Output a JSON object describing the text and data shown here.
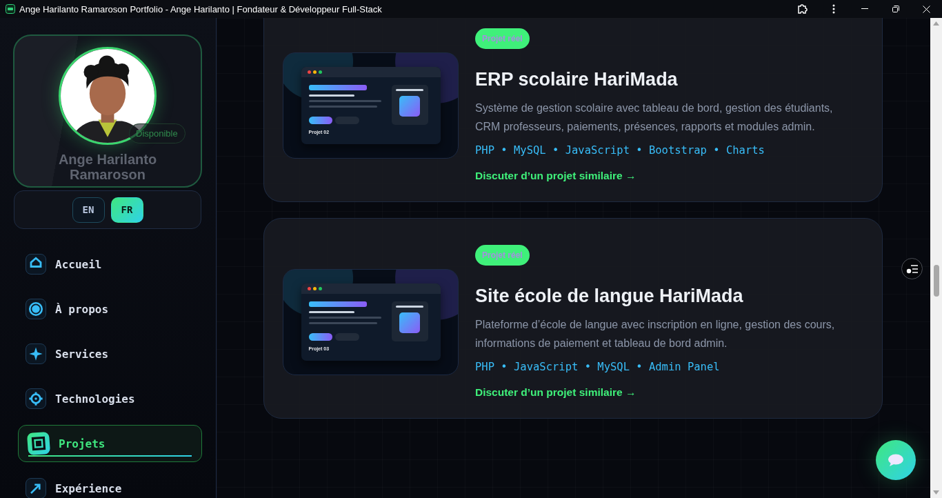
{
  "window": {
    "title": "Ange Harilanto Ramaroson Portfolio - Ange Harilanto | Fondateur & Développeur Full-Stack"
  },
  "profile": {
    "status": "Disponible",
    "name_lines": [
      "Ange Harilanto",
      "Ramaroson"
    ]
  },
  "languages": [
    {
      "label": "EN",
      "selected": false
    },
    {
      "label": "FR",
      "selected": true
    }
  ],
  "nav": [
    {
      "label": "Accueil",
      "selected": false
    },
    {
      "label": "À propos",
      "selected": false
    },
    {
      "label": "Services",
      "selected": false
    },
    {
      "label": "Technologies",
      "selected": false
    },
    {
      "label": "Projets",
      "selected": true
    },
    {
      "label": "Expérience",
      "selected": false
    }
  ],
  "projects": [
    {
      "badge": "Projet réel",
      "mockup_label": "Projet 02",
      "title": "ERP scolaire HariMada",
      "description": "Système de gestion scolaire avec tableau de bord, gestion des étudiants, CRM professeurs, paiements, présences, rapports et modules admin.",
      "stack": "PHP • MySQL • JavaScript • Bootstrap • Charts",
      "link": "Discuter d’un projet similaire →"
    },
    {
      "badge": "Projet réel",
      "mockup_label": "Projet 03",
      "title": "Site école de langue HariMada",
      "description": "Plateforme d’école de langue avec inscription en ligne, gestion des cours, informations de paiement et tableau de bord admin.",
      "stack": "PHP • JavaScript • MySQL • Admin Panel",
      "link": "Discuter d’un projet similaire →"
    }
  ]
}
